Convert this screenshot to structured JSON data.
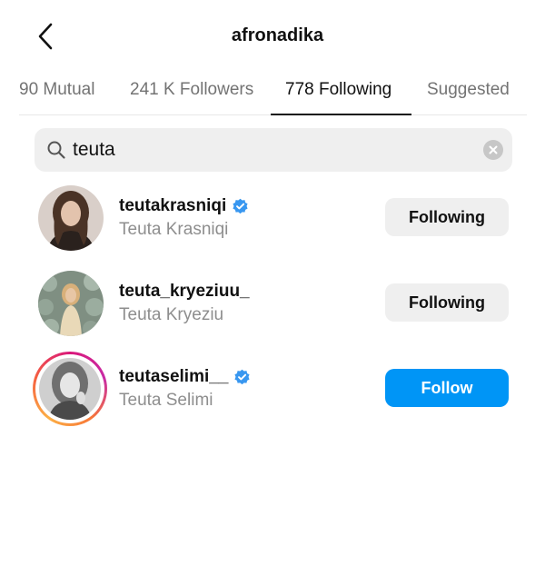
{
  "header": {
    "title": "afronadika"
  },
  "tabs": [
    {
      "label": "90 Mutual",
      "active": false
    },
    {
      "label": "241 K Followers",
      "active": false
    },
    {
      "label": "778 Following",
      "active": true
    },
    {
      "label": "Suggested",
      "active": false
    }
  ],
  "search": {
    "value": "teuta"
  },
  "users": [
    {
      "username": "teutakrasniqi",
      "full_name": "Teuta Krasniqi",
      "verified": true,
      "button_label": "Following",
      "button_style": "following",
      "story_ring": false
    },
    {
      "username": "teuta_kryeziuu_",
      "full_name": "Teuta Kryeziu",
      "verified": false,
      "button_label": "Following",
      "button_style": "following",
      "story_ring": false
    },
    {
      "username": "teutaselimi__",
      "full_name": "Teuta Selimi",
      "verified": true,
      "button_label": "Follow",
      "button_style": "follow",
      "story_ring": true
    }
  ],
  "colors": {
    "primary_blue": "#0095f6",
    "verified_blue": "#3897f0",
    "secondary_text": "#8e8e8e"
  }
}
